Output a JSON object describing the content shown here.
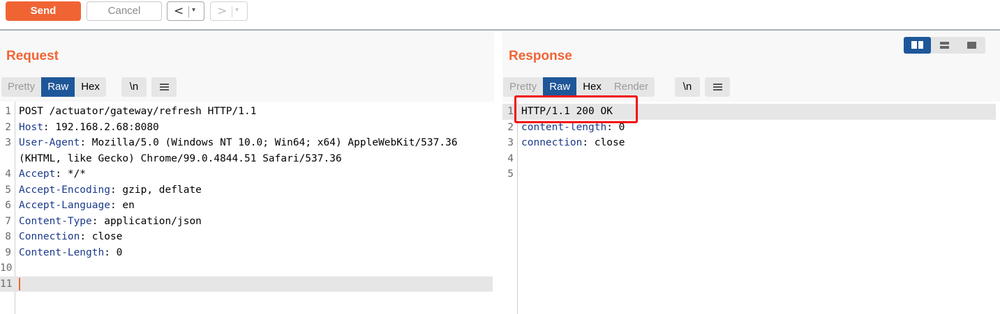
{
  "toolbar": {
    "send_label": "Send",
    "cancel_label": "Cancel",
    "back_arrow": "<",
    "forward_arrow": ">",
    "dropdown_glyph": "▾"
  },
  "request": {
    "title": "Request",
    "tabs": [
      "Pretty",
      "Raw",
      "Hex"
    ],
    "active_tab": "Raw",
    "newline_label": "\\n",
    "lines": [
      {
        "no": "1",
        "key": "",
        "val": "POST /actuator/gateway/refresh HTTP/1.1"
      },
      {
        "no": "2",
        "key": "Host",
        "val": ": 192.168.2.68:8080"
      },
      {
        "no": "3",
        "key": "User-Agent",
        "val": ": Mozilla/5.0 (Windows NT 10.0; Win64; x64) AppleWebKit/537.36"
      },
      {
        "no": "",
        "key": "",
        "val": "(KHTML, like Gecko) Chrome/99.0.4844.51 Safari/537.36"
      },
      {
        "no": "4",
        "key": "Accept",
        "val": ": */*"
      },
      {
        "no": "5",
        "key": "Accept-Encoding",
        "val": ": gzip, deflate"
      },
      {
        "no": "6",
        "key": "Accept-Language",
        "val": ": en"
      },
      {
        "no": "7",
        "key": "Content-Type",
        "val": ": application/json"
      },
      {
        "no": "8",
        "key": "Connection",
        "val": ": close"
      },
      {
        "no": "9",
        "key": "Content-Length",
        "val": ": 0"
      },
      {
        "no": "10",
        "key": "",
        "val": ""
      },
      {
        "no": "11",
        "key": "",
        "val": ""
      }
    ]
  },
  "response": {
    "title": "Response",
    "tabs": [
      "Pretty",
      "Raw",
      "Hex",
      "Render"
    ],
    "active_tab": "Raw",
    "newline_label": "\\n",
    "lines": [
      {
        "no": "1",
        "key": "",
        "val": "HTTP/1.1 200 OK"
      },
      {
        "no": "2",
        "key": "content-length",
        "val": ": 0"
      },
      {
        "no": "3",
        "key": "connection",
        "val": ": close"
      },
      {
        "no": "4",
        "key": "",
        "val": ""
      },
      {
        "no": "5",
        "key": "",
        "val": ""
      }
    ]
  },
  "layout_switch": {
    "options": [
      "side-by-side",
      "stacked",
      "single"
    ],
    "active": "side-by-side"
  },
  "colors": {
    "accent": "#f06434",
    "active_tab": "#1e5799",
    "header_key": "#1a3a8a",
    "highlight_box": "#f20d0d"
  }
}
